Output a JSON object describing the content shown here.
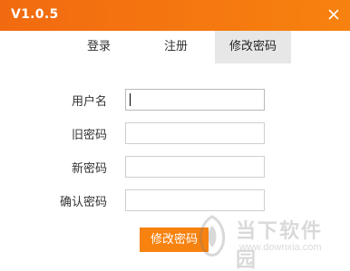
{
  "window": {
    "title": "V1.0.5",
    "close_icon": "close-icon"
  },
  "tabs": [
    {
      "label": "登录",
      "active": false
    },
    {
      "label": "注册",
      "active": false
    },
    {
      "label": "修改密码",
      "active": true
    }
  ],
  "form": {
    "fields": [
      {
        "label": "用户名",
        "value": ""
      },
      {
        "label": "旧密码",
        "value": ""
      },
      {
        "label": "新密码",
        "value": ""
      },
      {
        "label": "确认密码",
        "value": ""
      }
    ],
    "submit_label": "修改密码"
  },
  "watermark": {
    "name": "当下软件园",
    "url": "www.downxia.com"
  },
  "colors": {
    "accent": "#f7820f",
    "titlebar_start": "#f26a10",
    "active_tab": "#e7e7e7"
  }
}
